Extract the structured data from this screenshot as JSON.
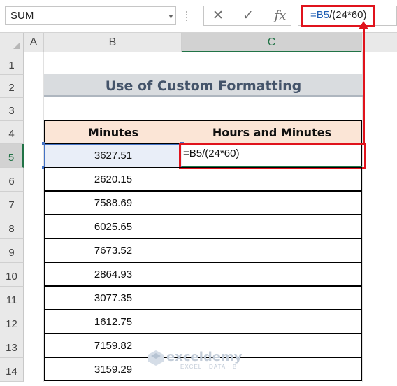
{
  "formula_bar": {
    "name_box": "SUM",
    "cancel_symbol": "✕",
    "enter_symbol": "✓",
    "fx_symbol": "fx",
    "formula_ref": "=B5",
    "formula_rest": "/(24*60)"
  },
  "columns": [
    "A",
    "B",
    "C"
  ],
  "rows": [
    "1",
    "2",
    "3",
    "4",
    "5",
    "6",
    "7",
    "8",
    "9",
    "10",
    "11",
    "12",
    "13",
    "14"
  ],
  "title": "Use of Custom Formatting",
  "table": {
    "headers": [
      "Minutes",
      "Hours and Minutes"
    ],
    "minutes": [
      "3627.51",
      "2620.15",
      "7588.69",
      "6025.65",
      "7673.52",
      "2864.93",
      "3077.35",
      "1612.75",
      "7159.82",
      "3159.29"
    ],
    "active_cell_formula": "=B5/(24*60)"
  },
  "watermark": {
    "name": "exceldemy",
    "tagline": "EXCEL · DATA · BI"
  },
  "colors": {
    "highlight": "#e0131c",
    "header_fill": "#fbe5d6",
    "title_fill": "#d9dcdf",
    "excel_green": "#217346"
  }
}
